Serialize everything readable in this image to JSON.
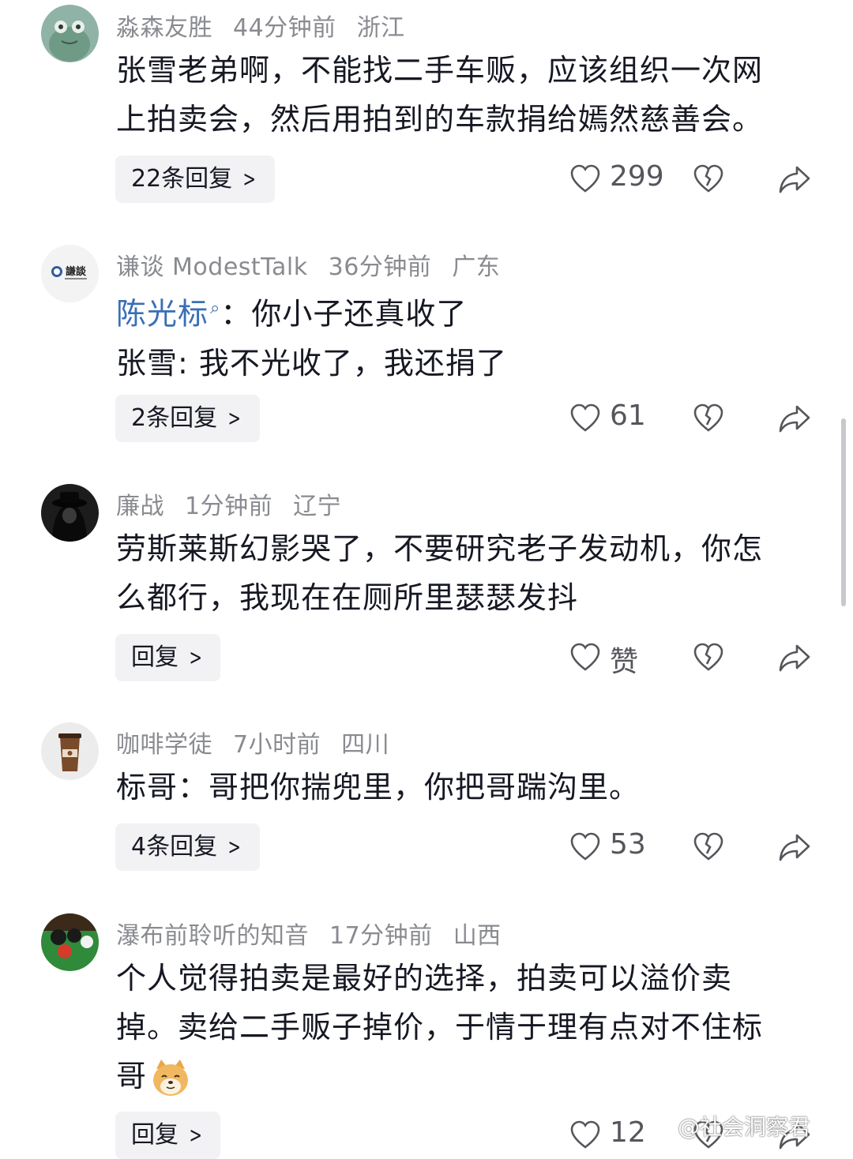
{
  "comments": [
    {
      "user": "淼森友胜",
      "time": "44分钟前",
      "location": "浙江",
      "avatar_icon": "frog-avatar-icon",
      "text_line1": "张雪老弟啊，不能找二手车贩，应该组织一次网",
      "text_line2": "上拍卖会，然后用拍到的车款捐给嫣然慈善会。",
      "reply_label": "22条回复",
      "likes": "299"
    },
    {
      "user": "谦谈 ModestTalk",
      "time": "36分钟前",
      "location": "广东",
      "avatar_icon": "modesttalk-logo-icon",
      "avatar_text": "謙談",
      "mention": "陈光标",
      "text_line1_rest": "：你小子还真收了",
      "text_line2": "张雪: 我不光收了，我还捐了",
      "reply_label": "2条回复",
      "likes": "61"
    },
    {
      "user": "廉战",
      "time": "1分钟前",
      "location": "辽宁",
      "avatar_icon": "hooded-figure-avatar-icon",
      "text_line1": "劳斯莱斯幻影哭了，不要研究老子发动机，你怎",
      "text_line2": "么都行，我现在在厕所里瑟瑟发抖",
      "reply_label": "回复",
      "likes": "赞"
    },
    {
      "user": "咖啡学徒",
      "time": "7小时前",
      "location": "四川",
      "avatar_icon": "coffee-cup-avatar-icon",
      "text_line1": "标哥：哥把你揣兜里，你把哥踹沟里。",
      "reply_label": "4条回复",
      "likes": "53"
    },
    {
      "user": "瀑布前聆听的知音",
      "time": "17分钟前",
      "location": "山西",
      "avatar_icon": "billiard-balls-avatar-icon",
      "text_line1": "个人觉得拍卖是最好的选择，拍卖可以溢价卖",
      "text_line2": "掉。卖给二手贩子掉价，于情于理有点对不住标",
      "text_line3": "哥",
      "emoji": "doge-emoji-icon",
      "reply_label": "回复",
      "likes": "12"
    }
  ],
  "watermark": "@社会洞察君",
  "colors": {
    "text": "#161823",
    "meta": "#8a8b91",
    "mention": "#3a6fb5",
    "reply_bg": "#f2f2f4"
  }
}
